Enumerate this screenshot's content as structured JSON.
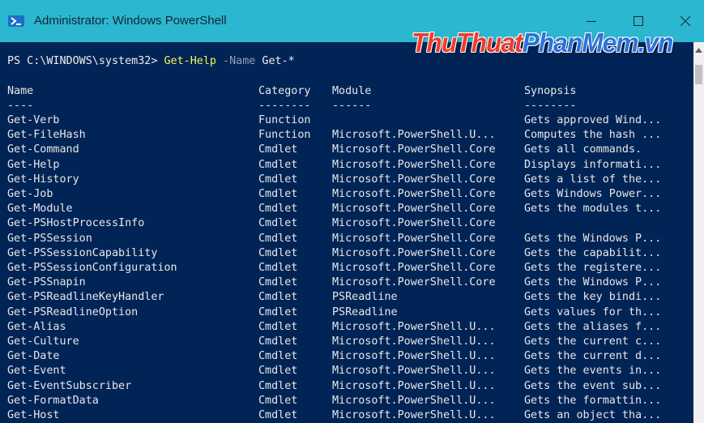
{
  "window": {
    "title": "Administrator: Windows PowerShell",
    "accent_color": "#2bb7cf",
    "console_background": "#012456",
    "icons": {
      "app": "powershell-icon",
      "minimize": "minimize-icon",
      "maximize": "maximize-icon",
      "close": "close-icon",
      "scroll_up": "scroll-up-arrow-icon"
    }
  },
  "watermark": {
    "part1": "ThuThuat",
    "part2": "PhanMem.vn"
  },
  "prompt": {
    "path": "PS C:\\WINDOWS\\system32> ",
    "command": "Get-Help",
    "parameter": " -Name",
    "argument": " Get-*"
  },
  "columns": [
    "Name",
    "Category",
    "Module",
    "Synopsis"
  ],
  "separators": [
    "----",
    "--------",
    "------",
    "--------"
  ],
  "rows": [
    [
      "Get-Verb",
      "Function",
      "",
      "Gets approved Wind..."
    ],
    [
      "Get-FileHash",
      "Function",
      "Microsoft.PowerShell.U...",
      "Computes the hash ..."
    ],
    [
      "Get-Command",
      "Cmdlet",
      "Microsoft.PowerShell.Core",
      "Gets all commands."
    ],
    [
      "Get-Help",
      "Cmdlet",
      "Microsoft.PowerShell.Core",
      "Displays informati..."
    ],
    [
      "Get-History",
      "Cmdlet",
      "Microsoft.PowerShell.Core",
      "Gets a list of the..."
    ],
    [
      "Get-Job",
      "Cmdlet",
      "Microsoft.PowerShell.Core",
      "Gets Windows Power..."
    ],
    [
      "Get-Module",
      "Cmdlet",
      "Microsoft.PowerShell.Core",
      "Gets the modules t..."
    ],
    [
      "Get-PSHostProcessInfo",
      "Cmdlet",
      "Microsoft.PowerShell.Core",
      ""
    ],
    [
      "Get-PSSession",
      "Cmdlet",
      "Microsoft.PowerShell.Core",
      "Gets the Windows P..."
    ],
    [
      "Get-PSSessionCapability",
      "Cmdlet",
      "Microsoft.PowerShell.Core",
      "Gets the capabilit..."
    ],
    [
      "Get-PSSessionConfiguration",
      "Cmdlet",
      "Microsoft.PowerShell.Core",
      "Gets the registere..."
    ],
    [
      "Get-PSSnapin",
      "Cmdlet",
      "Microsoft.PowerShell.Core",
      "Gets the Windows P..."
    ],
    [
      "Get-PSReadlineKeyHandler",
      "Cmdlet",
      "PSReadline",
      "Gets the key bindi..."
    ],
    [
      "Get-PSReadlineOption",
      "Cmdlet",
      "PSReadline",
      "Gets values for th..."
    ],
    [
      "Get-Alias",
      "Cmdlet",
      "Microsoft.PowerShell.U...",
      "Gets the aliases f..."
    ],
    [
      "Get-Culture",
      "Cmdlet",
      "Microsoft.PowerShell.U...",
      "Gets the current c..."
    ],
    [
      "Get-Date",
      "Cmdlet",
      "Microsoft.PowerShell.U...",
      "Gets the current d..."
    ],
    [
      "Get-Event",
      "Cmdlet",
      "Microsoft.PowerShell.U...",
      "Gets the events in..."
    ],
    [
      "Get-EventSubscriber",
      "Cmdlet",
      "Microsoft.PowerShell.U...",
      "Gets the event sub..."
    ],
    [
      "Get-FormatData",
      "Cmdlet",
      "Microsoft.PowerShell.U...",
      "Gets the formattin..."
    ],
    [
      "Get-Host",
      "Cmdlet",
      "Microsoft.PowerShell.U...",
      "Gets an object tha..."
    ]
  ]
}
